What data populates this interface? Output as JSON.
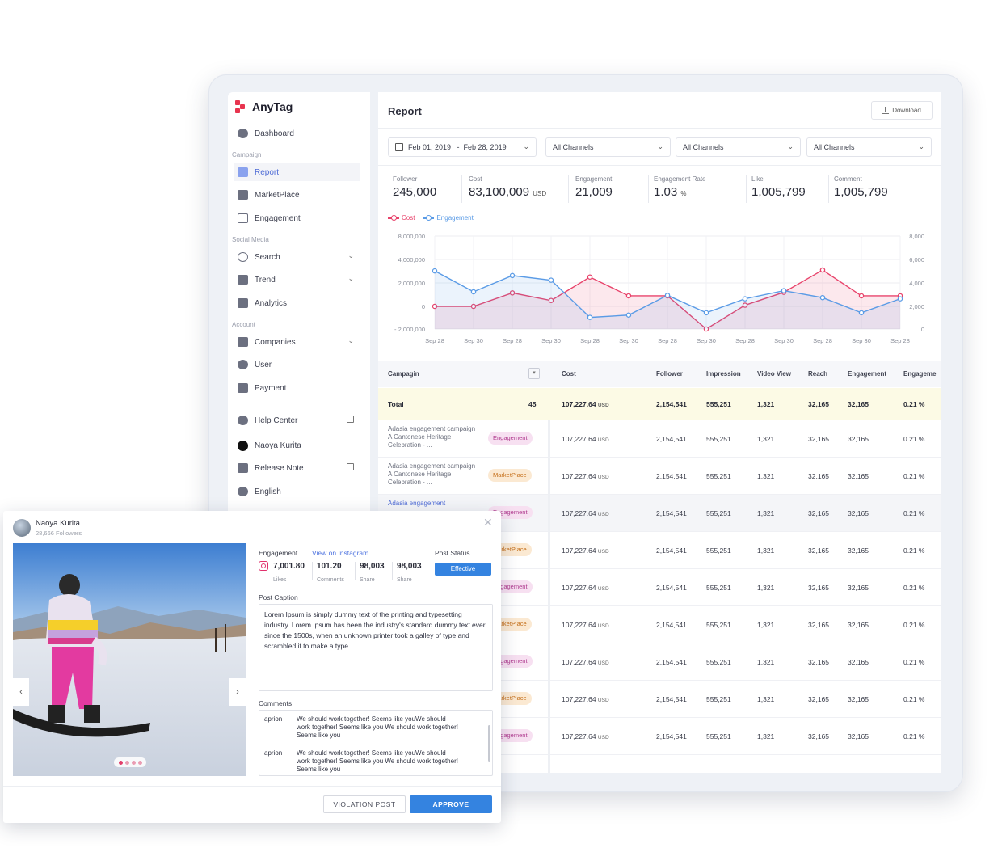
{
  "app": {
    "logo": "AnyTag"
  },
  "sidebar": {
    "dashboard": "Dashboard",
    "section_campaign": "Campaign",
    "report": "Report",
    "marketplace": "MarketPlace",
    "engagement": "Engagement",
    "section_social": "Social Media",
    "search": "Search",
    "trend": "Trend",
    "analytics": "Analytics",
    "section_account": "Account",
    "companies": "Companies",
    "user": "User",
    "payment": "Payment",
    "help": "Help Center",
    "profile": "Naoya Kurita",
    "release": "Release Note",
    "language": "English"
  },
  "report": {
    "title": "Report",
    "download": "Download",
    "date_range": "Feb 01, 2019   -  Feb 28, 2019",
    "filters": [
      "All Channels",
      "All Channels",
      "All Channels"
    ],
    "stats": [
      {
        "label": "Follower",
        "value": "245,000",
        "unit": ""
      },
      {
        "label": "Cost",
        "value": "83,100,009",
        "unit": "USD"
      },
      {
        "label": "Engagement",
        "value": "21,009",
        "unit": ""
      },
      {
        "label": "Engagement Rate",
        "value": "1.03",
        "unit": "%"
      },
      {
        "label": "Like",
        "value": "1,005,799",
        "unit": ""
      },
      {
        "label": "Comment",
        "value": "1,005,799",
        "unit": ""
      }
    ],
    "legend": {
      "cost": "Cost",
      "engagement": "Engagement"
    }
  },
  "chart_data": {
    "type": "line",
    "categories": [
      "Sep 28",
      "Sep 30",
      "Sep 28",
      "Sep 30",
      "Sep 28",
      "Sep 30",
      "Sep 28",
      "Sep 30",
      "Sep 28",
      "Sep 30",
      "Sep 28",
      "Sep 30",
      "Sep 28"
    ],
    "series": [
      {
        "name": "Cost",
        "axis": "left",
        "color": "#e8436b",
        "values": [
          0,
          0,
          1150000,
          500000,
          2500000,
          900000,
          900000,
          -2000000,
          100000,
          1200000,
          3100000,
          900000,
          900000
        ]
      },
      {
        "name": "Engagement",
        "axis": "right",
        "color": "#5a9be6",
        "values": [
          5000,
          3200,
          4600,
          4200,
          1000,
          1200,
          2900,
          1400,
          2600,
          3300,
          2700,
          1400,
          2600
        ]
      }
    ],
    "left_ticks": [
      "8,000,000",
      "4,000,000",
      "2,000,000",
      "0",
      "- 2,000,000"
    ],
    "right_ticks": [
      "8,000",
      "6,000",
      "4,000",
      "2,000",
      "0"
    ],
    "ylim_left": [
      -2000000,
      8000000
    ],
    "ylim_right": [
      0,
      8000
    ],
    "grid": true,
    "legend_position": "top-left"
  },
  "table": {
    "headers": [
      "Campagin",
      "Cost",
      "Follower",
      "Impression",
      "Video View",
      "Reach",
      "Engagement",
      "Engageme"
    ],
    "total": {
      "label": "Total",
      "count": "45",
      "cost": "107,227.64",
      "unit": "USD",
      "follower": "2,154,541",
      "impression": "555,251",
      "video_view": "1,321",
      "reach": "32,165",
      "engagement": "32,165",
      "rate": "0.21 %"
    },
    "rows": [
      {
        "campaign": "Adasia engagement campaign A Cantonese Heritage Celebration - ...",
        "tag": "Engagement",
        "cost": "107,227.64",
        "unit": "USD",
        "follower": "2,154,541",
        "impression": "555,251",
        "video_view": "1,321",
        "reach": "32,165",
        "engagement": "32,165",
        "rate": "0.21 %"
      },
      {
        "campaign": "Adasia engagement campaign A Cantonese Heritage Celebration - ...",
        "tag": "MarketPlace",
        "cost": "107,227.64",
        "unit": "USD",
        "follower": "2,154,541",
        "impression": "555,251",
        "video_view": "1,321",
        "reach": "32,165",
        "engagement": "32,165",
        "rate": "0.21 %"
      },
      {
        "campaign": "Adasia engagement",
        "tag": "Engagement",
        "cost": "107,227.64",
        "unit": "USD",
        "follower": "2,154,541",
        "impression": "555,251",
        "video_view": "1,321",
        "reach": "32,165",
        "engagement": "32,165",
        "rate": "0.21 %"
      },
      {
        "campaign": "",
        "tag": "MarketPlace",
        "cost": "107,227.64",
        "unit": "USD",
        "follower": "2,154,541",
        "impression": "555,251",
        "video_view": "1,321",
        "reach": "32,165",
        "engagement": "32,165",
        "rate": "0.21 %"
      },
      {
        "campaign": "",
        "tag": "Engagement",
        "cost": "107,227.64",
        "unit": "USD",
        "follower": "2,154,541",
        "impression": "555,251",
        "video_view": "1,321",
        "reach": "32,165",
        "engagement": "32,165",
        "rate": "0.21 %"
      },
      {
        "campaign": "",
        "tag": "MarketPlace",
        "cost": "107,227.64",
        "unit": "USD",
        "follower": "2,154,541",
        "impression": "555,251",
        "video_view": "1,321",
        "reach": "32,165",
        "engagement": "32,165",
        "rate": "0.21 %"
      },
      {
        "campaign": "",
        "tag": "Engagement",
        "cost": "107,227.64",
        "unit": "USD",
        "follower": "2,154,541",
        "impression": "555,251",
        "video_view": "1,321",
        "reach": "32,165",
        "engagement": "32,165",
        "rate": "0.21 %"
      },
      {
        "campaign": "",
        "tag": "MarketPlace",
        "cost": "107,227.64",
        "unit": "USD",
        "follower": "2,154,541",
        "impression": "555,251",
        "video_view": "1,321",
        "reach": "32,165",
        "engagement": "32,165",
        "rate": "0.21 %"
      },
      {
        "campaign": "",
        "tag": "Engagement",
        "cost": "107,227.64",
        "unit": "USD",
        "follower": "2,154,541",
        "impression": "555,251",
        "video_view": "1,321",
        "reach": "32,165",
        "engagement": "32,165",
        "rate": "0.21 %"
      }
    ]
  },
  "modal": {
    "name": "Naoya Kurita",
    "followers": "28,666 Followers",
    "engagement_label": "Engagement",
    "view_link": "View on Instagram",
    "post_status_label": "Post Status",
    "status": "Effective",
    "metrics": [
      {
        "value": "7,001.80",
        "label": "Likes"
      },
      {
        "value": "101.20",
        "label": "Comments"
      },
      {
        "value": "98,003",
        "label": "Share"
      },
      {
        "value": "98,003",
        "label": "Share"
      }
    ],
    "caption_label": "Post Caption",
    "caption": "Lorem Ipsum is simply dummy text of the printing and typesetting industry. Lorem Ipsum has been the industry's standard dummy text ever since the 1500s, when an unknown printer took a galley of type and scrambled it to make a type",
    "comments_label": "Comments",
    "comments": [
      {
        "user": "aprion",
        "text": "We should work together! Seems like youWe should work together! Seems like you We should work together! Seems like you"
      },
      {
        "user": "aprion",
        "text": "We should work together! Seems like youWe should work together! Seems like you We should work together! Seems like you"
      }
    ],
    "violation_btn": "VIOLATION POST",
    "approve_btn": "APPROVE",
    "carousel": {
      "count": 4,
      "active": 0
    }
  }
}
